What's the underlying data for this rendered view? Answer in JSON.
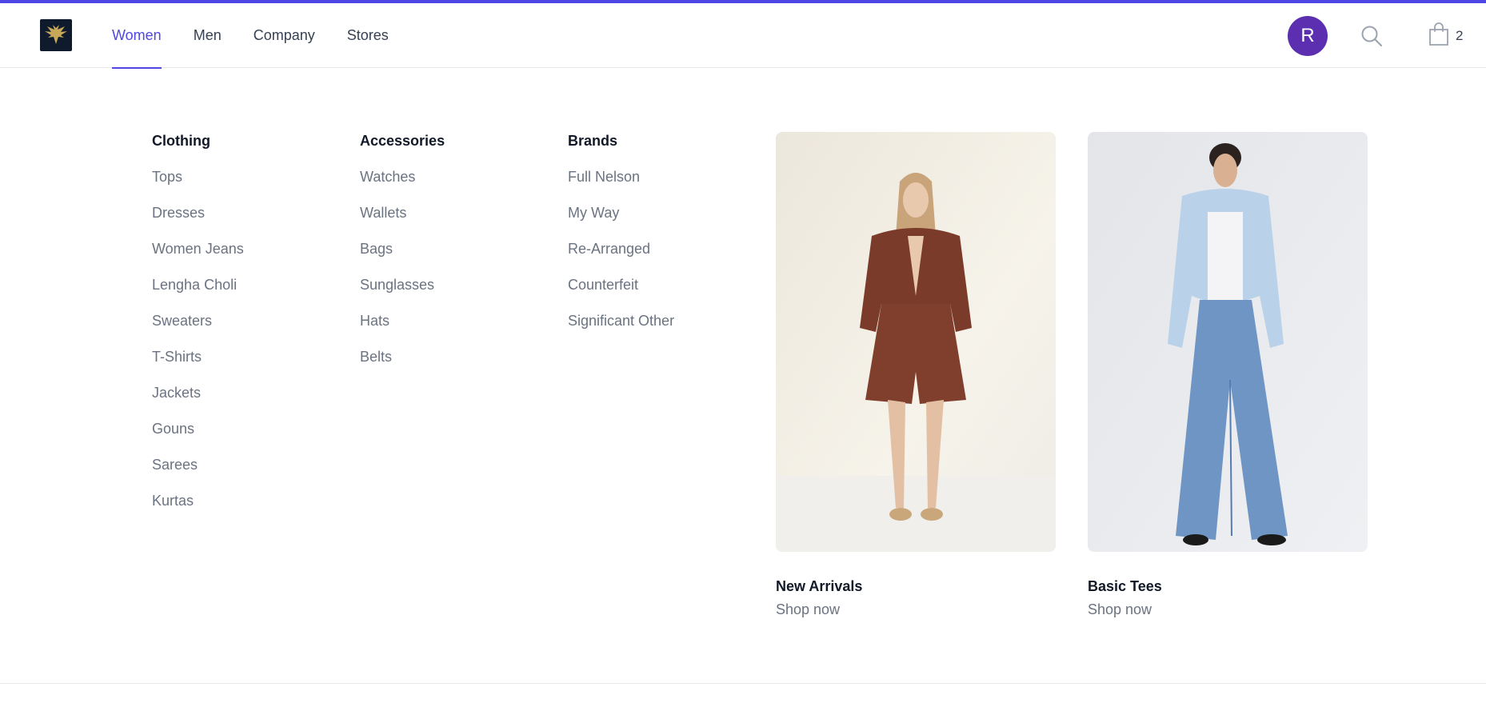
{
  "brand": {
    "logo_icon": "eagle-logo-icon",
    "accent_color": "#4f46e5"
  },
  "nav": {
    "items": [
      {
        "label": "Women",
        "active": true
      },
      {
        "label": "Men",
        "active": false
      },
      {
        "label": "Company",
        "active": false
      },
      {
        "label": "Stores",
        "active": false
      }
    ]
  },
  "header_actions": {
    "avatar_initial": "R",
    "avatar_color": "#5b2fb0",
    "search_icon": "search-icon",
    "cart_icon": "shopping-bag-icon",
    "cart_count": "2"
  },
  "menu": {
    "columns": [
      {
        "title": "Clothing",
        "items": [
          "Tops",
          "Dresses",
          "Women Jeans",
          "Lengha Choli",
          "Sweaters",
          "T-Shirts",
          "Jackets",
          "Gouns",
          "Sarees",
          "Kurtas"
        ]
      },
      {
        "title": "Accessories",
        "items": [
          "Watches",
          "Wallets",
          "Bags",
          "Sunglasses",
          "Hats",
          "Belts"
        ]
      },
      {
        "title": "Brands",
        "items": [
          "Full Nelson",
          "My Way",
          "Re-Arranged",
          "Counterfeit",
          "Significant Other"
        ]
      }
    ],
    "featured": [
      {
        "title": "New Arrivals",
        "link": "Shop now",
        "image": "model-brown-suit-photo"
      },
      {
        "title": "Basic Tees",
        "link": "Shop now",
        "image": "model-denim-jeans-photo"
      }
    ]
  }
}
